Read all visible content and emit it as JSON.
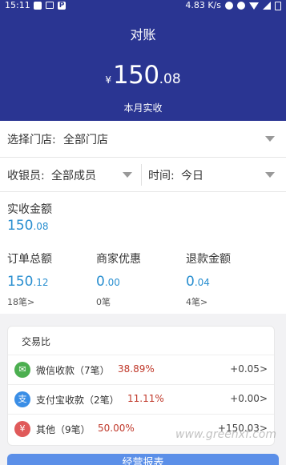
{
  "status_bar": {
    "time": "15:11",
    "speed": "4.83 K/s",
    "icons": [
      "notification-icon",
      "image-icon",
      "parking-icon",
      "mute-icon",
      "alarm-off-icon",
      "wifi-icon",
      "signal-icon",
      "battery-icon"
    ]
  },
  "header": {
    "title": "对账",
    "currency": "¥",
    "amount_int": "150",
    "amount_dec": ".08",
    "subtitle": "本月实收",
    "bg_color": "#2a3592"
  },
  "filters": {
    "store_label": "选择门店:",
    "store_value": "全部门店",
    "cashier_label": "收银员:",
    "cashier_value": "全部成员",
    "time_label": "时间:",
    "time_value": "今日"
  },
  "totals": {
    "received_label": "实收金额",
    "received_int": "150",
    "received_dec": ".08",
    "orders_label": "订单总额",
    "orders_int": "150",
    "orders_dec": ".12",
    "orders_count": "18笔>",
    "discount_label": "商家优惠",
    "discount_int": "0",
    "discount_dec": ".00",
    "discount_count": "0笔",
    "refund_label": "退款金额",
    "refund_int": "0",
    "refund_dec": ".04",
    "refund_count": "4笔>",
    "accent_color": "#2a8fd0"
  },
  "ratio": {
    "title": "交易比",
    "rows": [
      {
        "icon": "wechat-icon",
        "icon_color": "#4caf50",
        "name": "微信收款（7笔）",
        "pct": "38.89%",
        "amount": "+0.05>"
      },
      {
        "icon": "alipay-icon",
        "icon_color": "#3a8ee6",
        "name": "支付宝收款（2笔）",
        "pct": "11.11%",
        "amount": "+0.00>"
      },
      {
        "icon": "yen-icon",
        "icon_color": "#e05a5a",
        "name": "其他（9笔）",
        "pct": "50.00%",
        "amount": "+150.03>"
      }
    ]
  },
  "bottom_button": "经营报表",
  "watermark": "www.greenxf.com"
}
